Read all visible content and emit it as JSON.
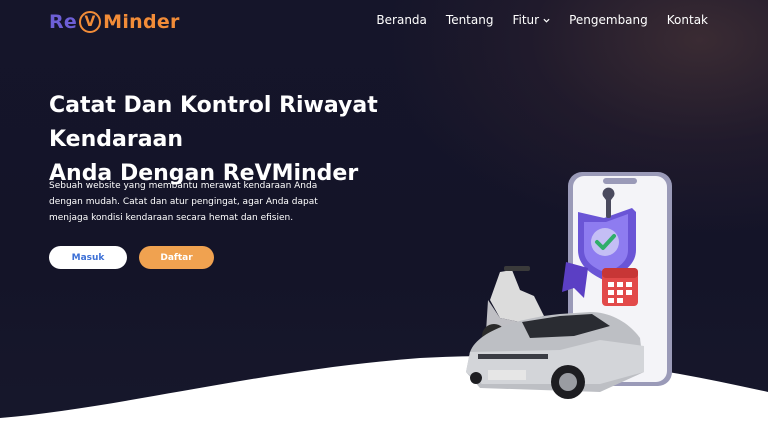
{
  "brand": {
    "part1": "Re",
    "part2": "V",
    "part3": "Minder"
  },
  "nav": {
    "items": [
      {
        "label": "Beranda"
      },
      {
        "label": "Tentang"
      },
      {
        "label": "Fitur"
      },
      {
        "label": "Pengembang"
      },
      {
        "label": "Kontak"
      }
    ]
  },
  "hero": {
    "title_line1": "Catat Dan Kontrol Riwayat Kendaraan",
    "title_line2": "Anda Dengan ReVMinder",
    "desc_line1": "Sebuah website yang membantu merawat kendaraan Anda",
    "desc_line2": "dengan mudah. Catat dan atur pengingat, agar Anda dapat",
    "desc_line3": "menjaga kondisi kendaraan secara hemat dan efisien.",
    "login_label": "Masuk",
    "register_label": "Daftar"
  },
  "colors": {
    "brand_purple": "#6d5fd6",
    "brand_orange": "#f28c38",
    "hero_bg": "#15152a"
  }
}
